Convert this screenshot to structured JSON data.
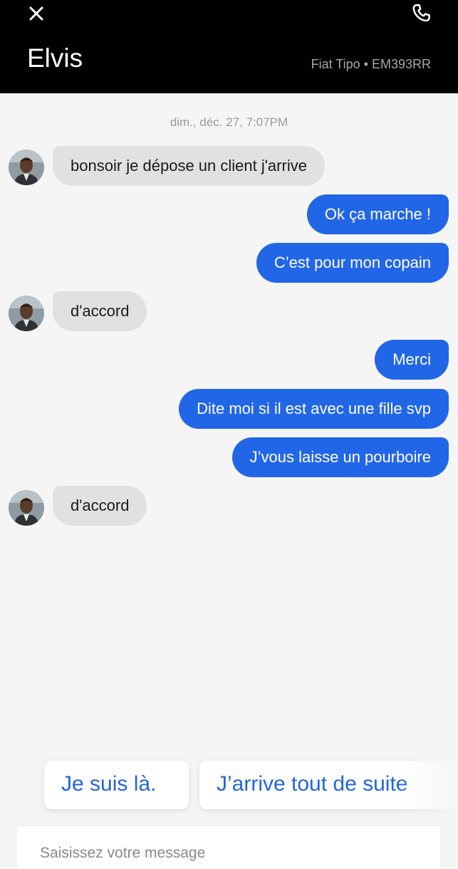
{
  "header": {
    "close_icon": "close-icon",
    "call_icon": "phone-icon",
    "contact_name": "Elvis",
    "vehicle": "Fiat Tipo • EM393RR"
  },
  "chat": {
    "timestamp": "dim., déc. 27, 7:07PM",
    "messages": [
      {
        "direction": "incoming",
        "text": "bonsoir je dépose un client j'arrive"
      },
      {
        "direction": "outgoing",
        "text": "Ok ça marche !"
      },
      {
        "direction": "outgoing",
        "text": "C’est pour mon copain"
      },
      {
        "direction": "incoming",
        "text": "d'accord"
      },
      {
        "direction": "outgoing",
        "text": "Merci"
      },
      {
        "direction": "outgoing",
        "text": "Dite moi si il est avec une fille svp"
      },
      {
        "direction": "outgoing",
        "text": "J’vous laisse un pourboire"
      },
      {
        "direction": "incoming",
        "text": "d'accord"
      }
    ]
  },
  "quick_replies": [
    "Je suis là.",
    "J’arrive tout de suite"
  ],
  "composer": {
    "placeholder": "Saisissez votre message"
  },
  "colors": {
    "header_bg": "#000000",
    "outgoing_bubble": "#2266e8",
    "incoming_bubble": "#e1e1e1",
    "quick_reply_text": "#2266d9",
    "background": "#f5f5f5"
  }
}
